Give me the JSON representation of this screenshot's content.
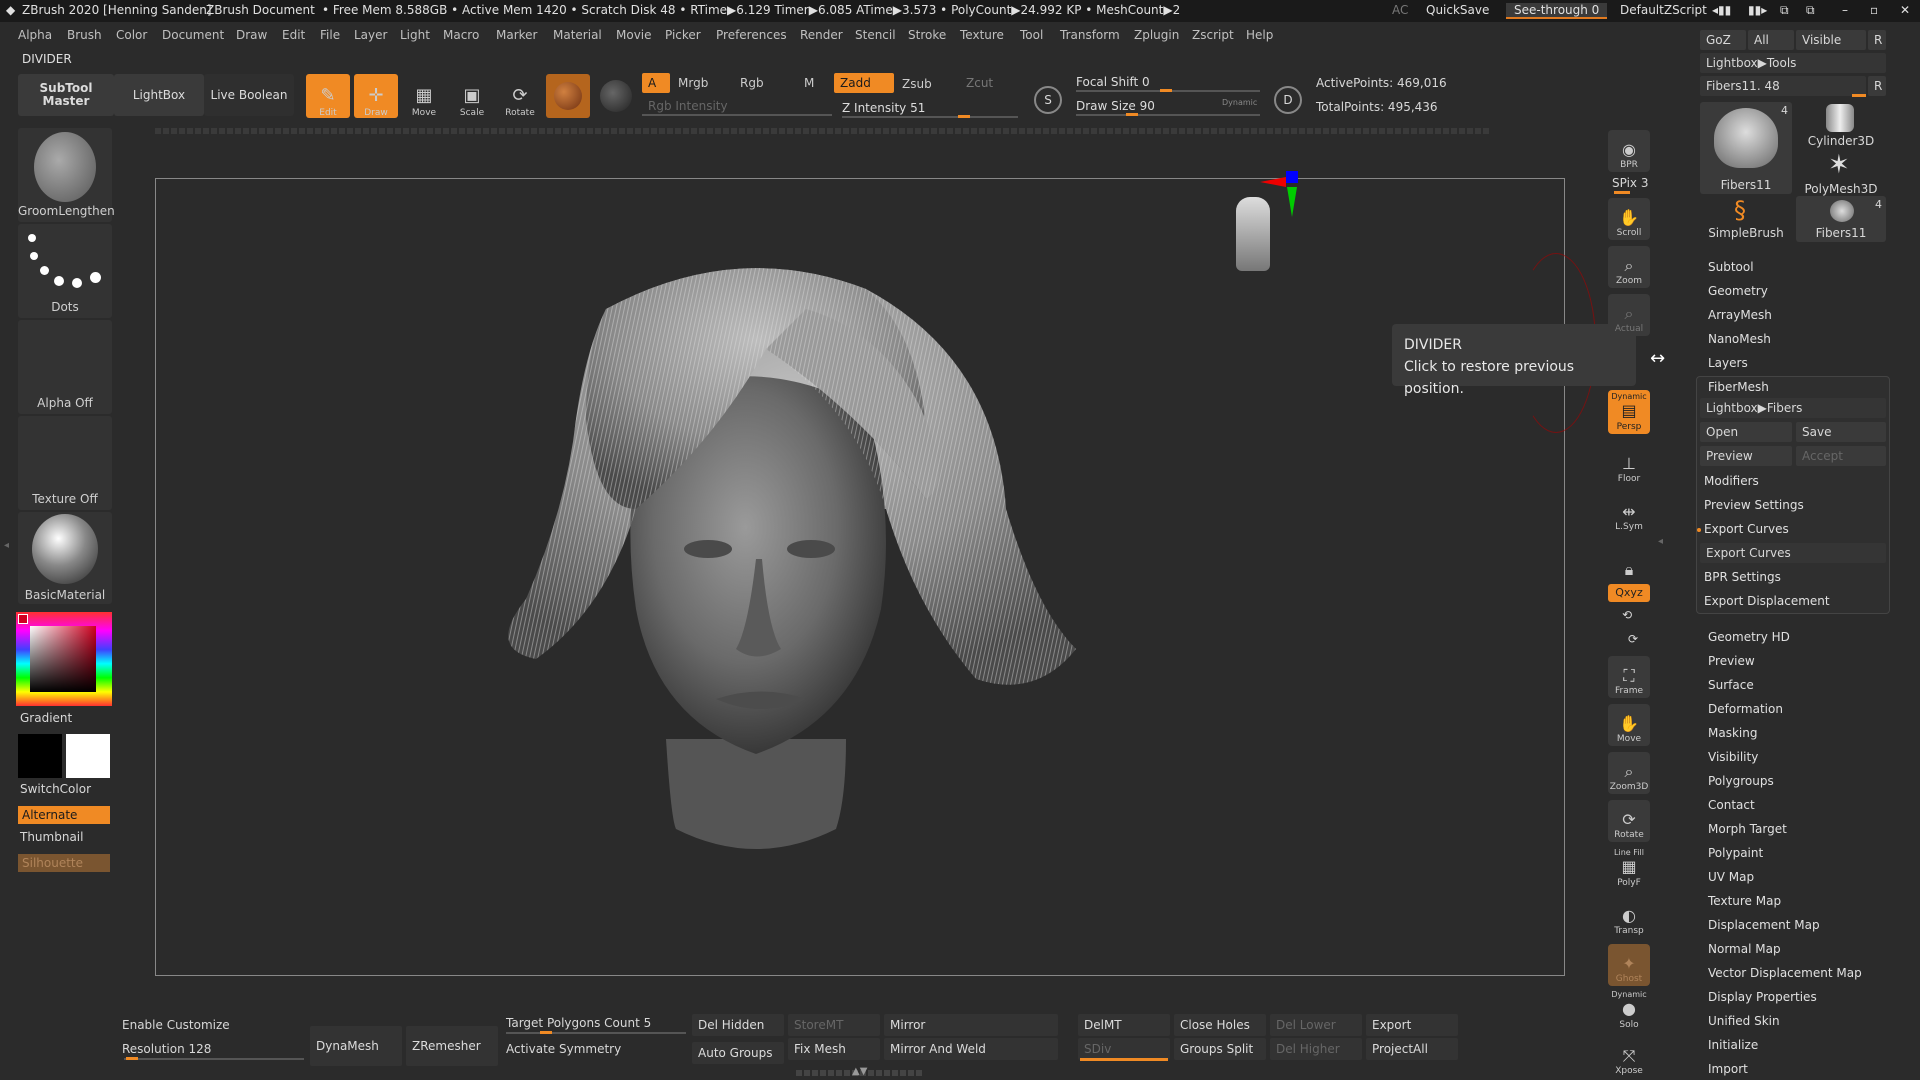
{
  "titlebar": {
    "app_title": "ZBrush 2020 [Henning Sanden]",
    "document": "ZBrush Document",
    "stats": "• Free Mem 8.588GB • Active Mem 1420 • Scratch Disk 48 • RTime▶6.129 Timer▶6.085 ATime▶3.573 • PolyCount▶24.992 KP • MeshCount▶2",
    "ac": "AC",
    "quicksave": "QuickSave",
    "see_through": "See-through  0",
    "script": "DefaultZScript"
  },
  "menu": [
    "Alpha",
    "Brush",
    "Color",
    "Document",
    "Draw",
    "Edit",
    "File",
    "Layer",
    "Light",
    "Macro",
    "Marker",
    "Material",
    "Movie",
    "Picker",
    "Preferences",
    "Render",
    "Stencil",
    "Stroke",
    "Texture",
    "Tool",
    "Transform",
    "Zplugin",
    "Zscript",
    "Help"
  ],
  "divider_label": "DIVIDER",
  "toolbar": {
    "subtool_master": "SubTool Master",
    "lightbox": "LightBox",
    "live_boolean": "Live Boolean",
    "edit": "Edit",
    "draw": "Draw",
    "move": "Move",
    "scale": "Scale",
    "rotate": "Rotate",
    "a": "A",
    "mrgb": "Mrgb",
    "rgb": "Rgb",
    "m": "M",
    "zadd": "Zadd",
    "zsub": "Zsub",
    "zcut": "Zcut",
    "rgb_intensity": "Rgb Intensity",
    "z_intensity": "Z Intensity 51",
    "focal_shift": "Focal Shift 0",
    "draw_size": "Draw Size 90",
    "dynamic": "Dynamic",
    "active_points": "ActivePoints: 469,016",
    "total_points": "TotalPoints: 495,436",
    "s_label": "S",
    "d_label": "D"
  },
  "toolbar_values": {
    "z_intensity": 51,
    "draw_size": 90,
    "focal_shift": 0
  },
  "left_shelf": {
    "brush": "GroomLengthen",
    "stroke": "Dots",
    "alpha": "Alpha Off",
    "texture": "Texture Off",
    "material": "BasicMaterial",
    "gradient": "Gradient",
    "switchcolor": "SwitchColor",
    "alternate": "Alternate",
    "thumbnail": "Thumbnail",
    "silhouette": "Silhouette"
  },
  "right_shelf": {
    "bpr": "BPR",
    "spix": "SPix 3",
    "scroll": "Scroll",
    "zoom": "Zoom",
    "actual": "Actual",
    "dynamic": "Dynamic",
    "persp": "Persp",
    "floor": "Floor",
    "lsym": "L.Sym",
    "xyz": "Qxyz",
    "frame": "Frame",
    "move": "Move",
    "zoom3d": "Zoom3D",
    "rotate": "Rotate",
    "line_fill": "Line Fill",
    "polyf": "PolyF",
    "transp": "Transp",
    "ghost": "Ghost",
    "solo": "Solo",
    "xpose": "Xpose"
  },
  "tooltip": {
    "title": "DIVIDER",
    "text": "Click to restore previous position."
  },
  "palette": {
    "goz": "GoZ",
    "all": "All",
    "visible": "Visible",
    "r": "R",
    "lightbox_tools": "Lightbox▶Tools",
    "fibers_slider": "Fibers11. 48",
    "tools": [
      {
        "name": "Fibers11",
        "count": "4"
      },
      {
        "name": "Cylinder3D",
        "count": ""
      },
      {
        "name": "PolyMesh3D",
        "count": ""
      },
      {
        "name": "SimpleBrush",
        "count": ""
      },
      {
        "name": "Fibers11",
        "count": "4"
      }
    ],
    "section1": [
      "Subtool",
      "Geometry",
      "ArrayMesh",
      "NanoMesh",
      "Layers",
      "FiberMesh"
    ],
    "lightbox_fibers": "Lightbox▶Fibers",
    "open": "Open",
    "save": "Save",
    "preview": "Preview",
    "accept": "Accept",
    "modifiers": "Modifiers",
    "preview_settings": "Preview Settings",
    "export_curves_header": "Export Curves",
    "export_curves_button": "Export Curves",
    "bpr_settings": "BPR Settings",
    "export_displacement": "Export Displacement",
    "section2": [
      "Geometry HD",
      "Preview",
      "Surface",
      "Deformation",
      "Masking",
      "Visibility",
      "Polygroups",
      "Contact",
      "Morph Target",
      "Polypaint",
      "UV Map",
      "Texture Map",
      "Displacement Map",
      "Normal Map",
      "Vector Displacement Map",
      "Display Properties",
      "Unified Skin",
      "Initialize",
      "Import"
    ]
  },
  "bottom": {
    "enable_customize": "Enable Customize",
    "resolution": "Resolution 128",
    "dynamesh": "DynaMesh",
    "zremesher": "ZRemesher",
    "target_polygons": "Target Polygons Count 5",
    "activate_symmetry": "Activate Symmetry",
    "del_hidden": "Del Hidden",
    "auto_groups": "Auto Groups",
    "storemt": "StoreMT",
    "fix_mesh": "Fix Mesh",
    "mirror": "Mirror",
    "mirror_weld": "Mirror And Weld",
    "delmt": "DelMT",
    "sdiv": "SDiv",
    "close_holes": "Close Holes",
    "groups_split": "Groups Split",
    "del_lower": "Del Lower",
    "del_higher": "Del Higher",
    "export": "Export",
    "projectall": "ProjectAll"
  },
  "colors": {
    "accent": "#f08a24",
    "bg": "#2b2b2b",
    "panel": "#333333"
  }
}
